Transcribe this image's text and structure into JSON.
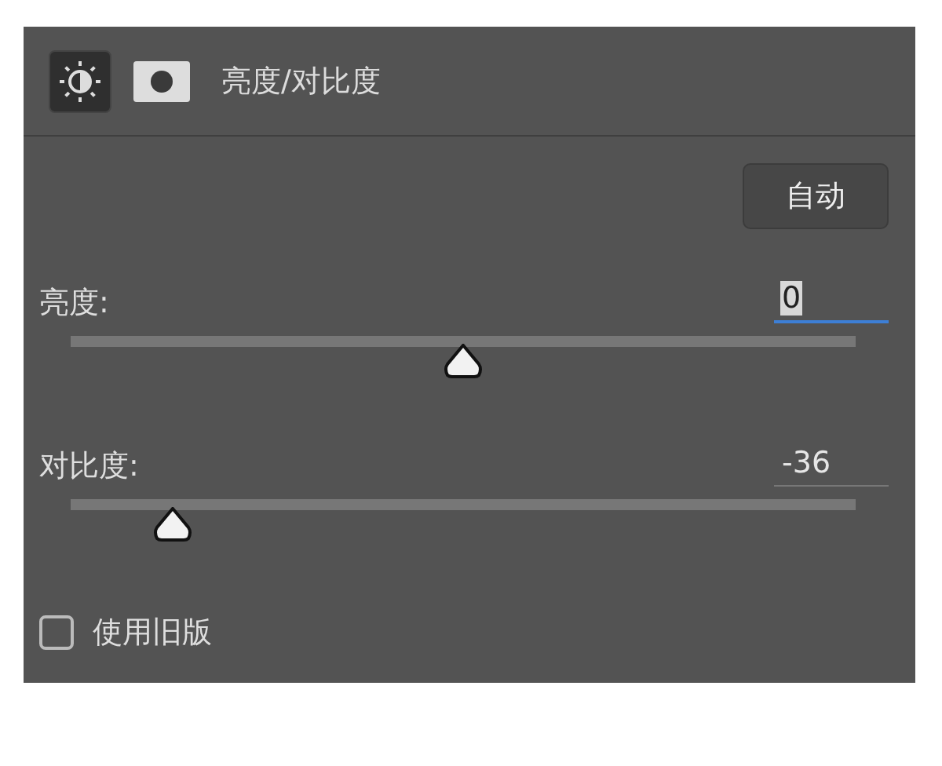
{
  "panel": {
    "tabs": [
      {
        "kind": "adjustment",
        "selected": true
      },
      {
        "kind": "mask",
        "selected": false
      }
    ],
    "title": "亮度/对比度"
  },
  "auto_button": "自动",
  "sliders": [
    {
      "label": "亮度:",
      "value": "0",
      "focused": true,
      "level": 0.5
    },
    {
      "label": "对比度:",
      "value": "-36",
      "focused": false,
      "level": 0.13
    }
  ],
  "legacy": {
    "label": "使用旧版",
    "checked": false
  }
}
